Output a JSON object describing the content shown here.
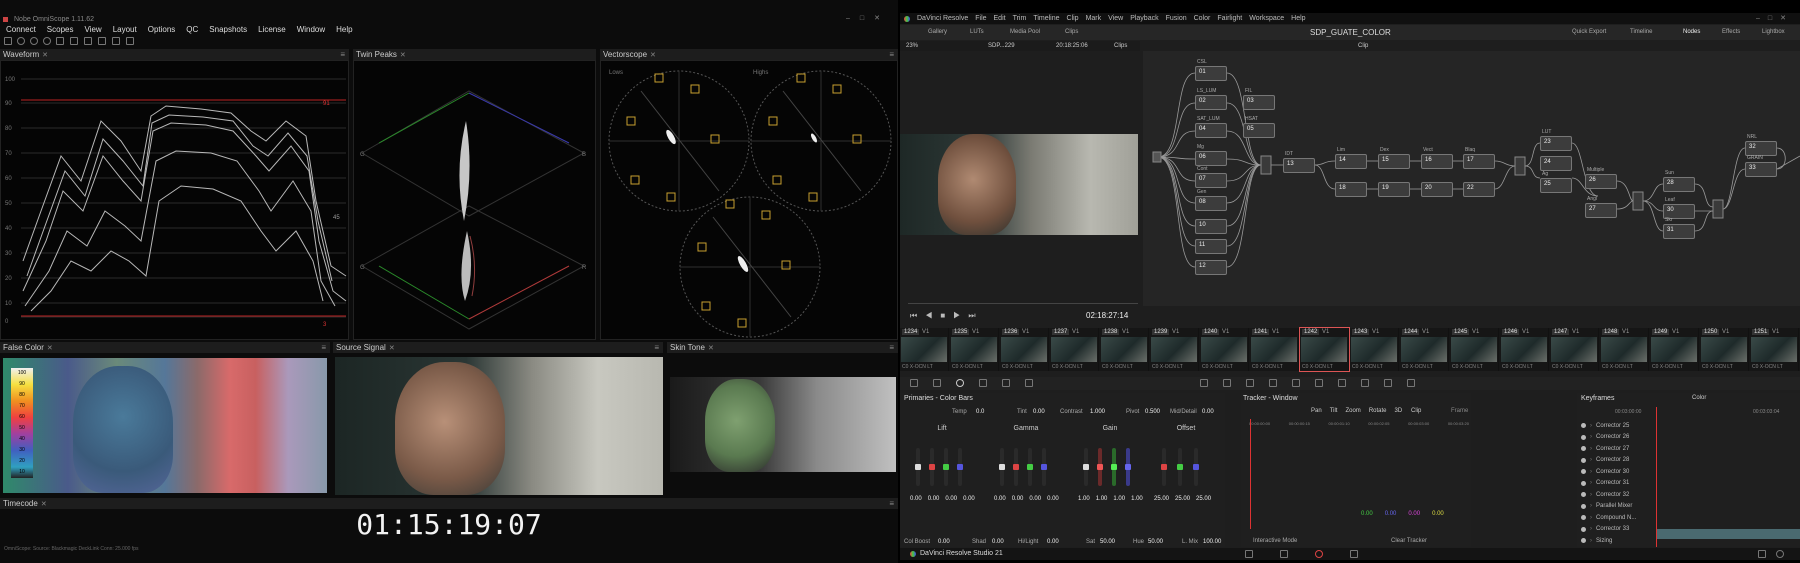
{
  "nobe": {
    "title": "Nobe OmniScope 1.11.62",
    "menu": [
      "Connect",
      "Scopes",
      "View",
      "Layout",
      "Options",
      "QC",
      "Snapshots",
      "License",
      "Window",
      "Help"
    ],
    "panels": {
      "waveform": "Waveform",
      "twin_peaks": "Twin Peaks",
      "vectorscope": "Vectorscope",
      "false_color": "False Color",
      "source_signal": "Source Signal",
      "skin_tone": "Skin Tone",
      "timecode": "Timecode"
    },
    "waveform_scale": [
      "100",
      "90",
      "80",
      "70",
      "60",
      "50",
      "40",
      "30",
      "20",
      "10",
      "0"
    ],
    "waveform_marks": {
      "top": "91",
      "mid": "45",
      "bottom": "3"
    },
    "vector_labels": {
      "lows": "Lows",
      "highs": "Highs"
    },
    "twin_labels": {
      "g": "G",
      "b": "B",
      "r": "R"
    },
    "false_scale": [
      "100",
      "90",
      "80",
      "70",
      "60",
      "50",
      "40",
      "30",
      "20",
      "10"
    ],
    "timecode": "01:15:19:07",
    "status": "OmniScope: Source: Blackmagic DeckLink  Conn: 25.000 fps"
  },
  "resolve": {
    "menu": [
      "DaVinci Resolve",
      "File",
      "Edit",
      "Trim",
      "Timeline",
      "Clip",
      "Mark",
      "View",
      "Playback",
      "Fusion",
      "Color",
      "Fairlight",
      "Workspace",
      "Help"
    ],
    "toolbar_left": [
      "Gallery",
      "LUTs",
      "Media Pool",
      "Clips"
    ],
    "project_title": "SDP_GUATE_COLOR",
    "clip_mode": "Clip",
    "toolbar_right": [
      "Quick Export",
      "Timeline",
      "Nodes",
      "Effects",
      "Lightbox"
    ],
    "viewer": {
      "zoom": "23%",
      "name": "SDP...229",
      "timecode_top": "20:18:25:06",
      "mode": "Clips",
      "timecode": "02:18:27:14"
    },
    "nodes": [
      {
        "label": "CSL",
        "num": "01"
      },
      {
        "label": "LS_LUM",
        "num": "02"
      },
      {
        "label": "FIL",
        "num": "03"
      },
      {
        "label": "SAT_LUM",
        "num": "04"
      },
      {
        "label": "HSAT",
        "num": "05"
      },
      {
        "label": "Mg",
        "num": "06"
      },
      {
        "label": "Cont",
        "num": "07"
      },
      {
        "label": "Gen",
        "num": "08"
      },
      {
        "label": "",
        "num": "10"
      },
      {
        "label": "",
        "num": "11"
      },
      {
        "label": "",
        "num": "12"
      },
      {
        "label": "IDT",
        "num": "13"
      },
      {
        "label": "Lim",
        "num": "14"
      },
      {
        "label": "Dex",
        "num": "15"
      },
      {
        "label": "Vect",
        "num": "16"
      },
      {
        "label": "Blaq",
        "num": "17"
      },
      {
        "label": "",
        "num": "18"
      },
      {
        "label": "",
        "num": "19"
      },
      {
        "label": "",
        "num": "20"
      },
      {
        "label": "",
        "num": "22"
      },
      {
        "label": "LUT",
        "num": "23"
      },
      {
        "label": "",
        "num": "24"
      },
      {
        "label": "Ag",
        "num": "25"
      },
      {
        "label": "Multiple",
        "num": "26"
      },
      {
        "label": "Angl",
        "num": "27"
      },
      {
        "label": "Sun",
        "num": "28"
      },
      {
        "label": "Leaf",
        "num": "30"
      },
      {
        "label": "Skr",
        "num": "31"
      },
      {
        "label": "NRL",
        "num": "32"
      },
      {
        "label": "GRAIN",
        "num": "33"
      }
    ],
    "clips": [
      {
        "num": "1234",
        "track": "V1"
      },
      {
        "num": "1235",
        "track": "V1"
      },
      {
        "num": "1236",
        "track": "V1"
      },
      {
        "num": "1237",
        "track": "V1"
      },
      {
        "num": "1238",
        "track": "V1"
      },
      {
        "num": "1239",
        "track": "V1"
      },
      {
        "num": "1240",
        "track": "V1"
      },
      {
        "num": "1241",
        "track": "V1"
      },
      {
        "num": "1242",
        "track": "V1"
      },
      {
        "num": "1243",
        "track": "V1"
      },
      {
        "num": "1244",
        "track": "V1"
      },
      {
        "num": "1245",
        "track": "V1"
      },
      {
        "num": "1246",
        "track": "V1"
      },
      {
        "num": "1247",
        "track": "V1"
      },
      {
        "num": "1248",
        "track": "V1"
      },
      {
        "num": "1249",
        "track": "V1"
      },
      {
        "num": "1250",
        "track": "V1"
      },
      {
        "num": "1251",
        "track": "V1"
      }
    ],
    "clip_label": "C0 X-OCN LT",
    "primaries": {
      "title": "Primaries - Color Bars",
      "temp_label": "Temp",
      "temp": "0.0",
      "tint_label": "Tint",
      "tint": "0.00",
      "contrast_label": "Contrast",
      "contrast": "1.000",
      "pivot_label": "Pivot",
      "pivot": "0.500",
      "middetail_label": "Mid/Detail",
      "middetail": "0.00",
      "wheels": [
        {
          "name": "Lift",
          "values": [
            "0.00",
            "0.00",
            "0.00",
            "0.00"
          ]
        },
        {
          "name": "Gamma",
          "values": [
            "0.00",
            "0.00",
            "0.00",
            "0.00"
          ]
        },
        {
          "name": "Gain",
          "values": [
            "1.00",
            "1.00",
            "1.00",
            "1.00"
          ]
        },
        {
          "name": "Offset",
          "values": [
            "25.00",
            "25.00",
            "25.00"
          ]
        }
      ],
      "colboost_label": "Col Boost",
      "colboost": "0.00",
      "shad_label": "Shad",
      "shad": "0.00",
      "hilight_label": "Hi/Light",
      "hilight": "0.00",
      "sat_label": "Sat",
      "sat": "50.00",
      "hue_label": "Hue",
      "hue": "50.00",
      "lmix_label": "L. Mix",
      "lmix": "100.00"
    },
    "tracker": {
      "title": "Tracker - Window",
      "checks": [
        "Pan",
        "Tilt",
        "Zoom",
        "Rotate",
        "3D"
      ],
      "mode": "Clip",
      "frame_label": "Frame",
      "ruler": [
        "00:00:00:00",
        "00:00:00:15",
        "00:00:01:10",
        "00:00:02:05",
        "00:00:03:00",
        "00:00:03:20"
      ],
      "values": [
        "0.00",
        "0.00",
        "0.00",
        "0.00"
      ],
      "interactive": "Interactive Mode",
      "clear": "Clear Tracker"
    },
    "keyframes": {
      "title": "Keyframes",
      "mode": "Color",
      "ruler_left": "00:03:00:00",
      "ruler_right": "00:03:03:04",
      "rows": [
        "Corrector 25",
        "Corrector 26",
        "Corrector 27",
        "Corrector 28",
        "Corrector 30",
        "Corrector 31",
        "Corrector 32",
        "Parallel Mixer",
        "Compound N...",
        "Corrector 33",
        "Sizing"
      ]
    },
    "footer": {
      "app": "DaVinci Resolve Studio 21"
    }
  }
}
